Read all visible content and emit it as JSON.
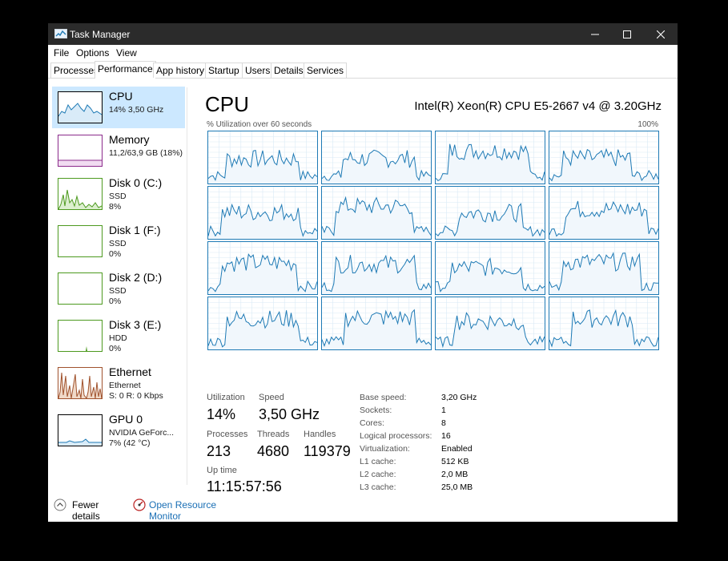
{
  "window": {
    "title": "Task Manager",
    "controls": {
      "minimize": "minimize",
      "maximize": "maximize",
      "close": "close"
    }
  },
  "menu": [
    "File",
    "Options",
    "View"
  ],
  "tabs": [
    "Processes",
    "Performance",
    "App history",
    "Startup",
    "Users",
    "Details",
    "Services"
  ],
  "active_tab": "Performance",
  "sidebar": [
    {
      "title": "CPU",
      "lines": [
        "14% 3,50 GHz"
      ],
      "color": "#1e7ab5",
      "active": true
    },
    {
      "title": "Memory",
      "lines": [
        "11,2/63,9 GB (18%)"
      ],
      "color": "#8b2a8b"
    },
    {
      "title": "Disk 0 (C:)",
      "lines": [
        "SSD",
        "8%"
      ],
      "color": "#4d9a1f"
    },
    {
      "title": "Disk 1 (F:)",
      "lines": [
        "SSD",
        "0%"
      ],
      "color": "#4d9a1f"
    },
    {
      "title": "Disk 2 (D:)",
      "lines": [
        "SSD",
        "0%"
      ],
      "color": "#4d9a1f"
    },
    {
      "title": "Disk 3 (E:)",
      "lines": [
        "HDD",
        "0%"
      ],
      "color": "#4d9a1f"
    },
    {
      "title": "Ethernet",
      "lines": [
        "Ethernet",
        "S: 0 R: 0 Kbps"
      ],
      "color": "#a0522d"
    },
    {
      "title": "GPU 0",
      "lines": [
        "NVIDIA GeForc...",
        "7% (42 °C)"
      ],
      "color": "#1e7ab5"
    }
  ],
  "main": {
    "title": "CPU",
    "cpu_name": "Intel(R) Xeon(R) CPU E5-2667 v4 @ 3.20GHz",
    "graph_caption": "% Utilization over 60 seconds",
    "graph_max": "100%",
    "graph_color": "#1e7ab5",
    "stats": {
      "utilization_label": "Utilization",
      "utilization": "14%",
      "speed_label": "Speed",
      "speed": "3,50 GHz",
      "processes_label": "Processes",
      "processes": "213",
      "threads_label": "Threads",
      "threads": "4680",
      "handles_label": "Handles",
      "handles": "119379",
      "uptime_label": "Up time",
      "uptime": "11:15:57:56"
    },
    "details": [
      {
        "key": "Base speed:",
        "value": "3,20 GHz"
      },
      {
        "key": "Sockets:",
        "value": "1"
      },
      {
        "key": "Cores:",
        "value": "8"
      },
      {
        "key": "Logical processors:",
        "value": "16"
      },
      {
        "key": "Virtualization:",
        "value": "Enabled"
      },
      {
        "key": "L1 cache:",
        "value": "512 KB"
      },
      {
        "key": "L2 cache:",
        "value": "2,0 MB"
      },
      {
        "key": "L3 cache:",
        "value": "25,0 MB"
      }
    ]
  },
  "footer": {
    "fewer_details": "Fewer details",
    "open_resource_monitor": "Open Resource Monitor"
  }
}
